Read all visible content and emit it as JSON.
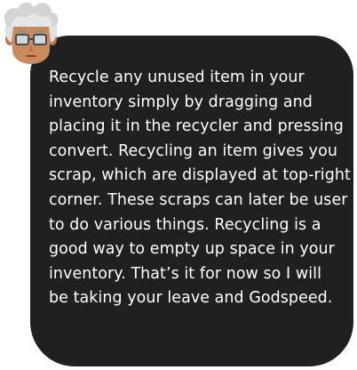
{
  "dialog": {
    "lines": [
      "Recycle any unused item in your",
      "inventory simply by dragging and",
      "placing it in the recycler and pressing",
      "convert. Recycling an item gives you",
      "scrap, which are displayed at top-right",
      "corner. These scraps can later be user",
      "to do various things. Recycling is a",
      "good way to empty up space in your",
      "inventory. That’s it for now so I will",
      "be taking your leave and Godspeed."
    ]
  },
  "speaker": {
    "icon": "old-professor-avatar"
  },
  "colors": {
    "dialog_bg": "#202020",
    "text": "#ffffff",
    "hair": "#d9d9d9",
    "skin": "#c98a5c",
    "glasses": "#4a4a4a"
  }
}
